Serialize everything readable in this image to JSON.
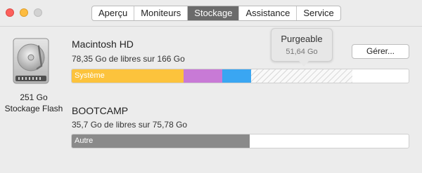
{
  "tabs": [
    {
      "label": "Aperçu",
      "active": false
    },
    {
      "label": "Moniteurs",
      "active": false
    },
    {
      "label": "Stockage",
      "active": true
    },
    {
      "label": "Assistance",
      "active": false
    },
    {
      "label": "Service",
      "active": false
    }
  ],
  "drive": {
    "size": "251 Go",
    "type": "Stockage Flash",
    "icon": "hard-drive-icon"
  },
  "volumes": [
    {
      "name": "Macintosh HD",
      "info": "78,35 Go de libres sur 166 Go",
      "segments": [
        {
          "label": "Système",
          "share": 0.331,
          "color": "#fcc33c"
        },
        {
          "label": "",
          "share": 0.114,
          "color": "#c87ad6"
        },
        {
          "label": "",
          "share": 0.085,
          "color": "#3aa6f2"
        },
        {
          "label": "",
          "share": 0.3,
          "color": "purgeable-hatch"
        }
      ]
    },
    {
      "name": "BOOTCAMP",
      "info": "35,7 Go de libres sur 75,78 Go",
      "segments": [
        {
          "label": "Autre",
          "share": 0.529,
          "color": "#8a8a8a"
        }
      ]
    }
  ],
  "manage_button": "Gérer...",
  "tooltip": {
    "title": "Purgeable",
    "value": "51,64 Go"
  }
}
